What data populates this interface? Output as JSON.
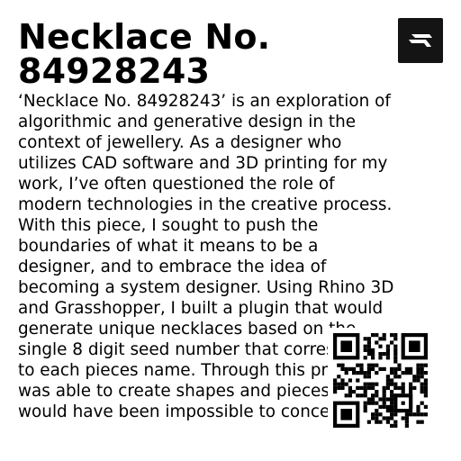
{
  "product": {
    "title": "Necklace No. 84928243",
    "description": "‘Necklace No. 84928243’ is an exploration of algorithmic and generative design in the context of jewellery. As a designer who utilizes CAD software and 3D printing for my work, I’ve often questioned the role of modern technologies in the creative process. With this piece, I sought to push the boundaries of what it means to be a designer, and to embrace the idea of becoming a system designer. Using Rhino 3D and Grasshopper, I built a plugin that would generate unique necklaces based on the single 8 digit seed number that corresponds to each pieces name. Through this process I was able to create shapes and pieces that would have been impossible to conceive"
  },
  "logo": {
    "icon": "brand-logo-icon",
    "background": "#141414",
    "foreground": "#ffffff"
  },
  "qr_code": {
    "icon": "qr-code-icon"
  }
}
